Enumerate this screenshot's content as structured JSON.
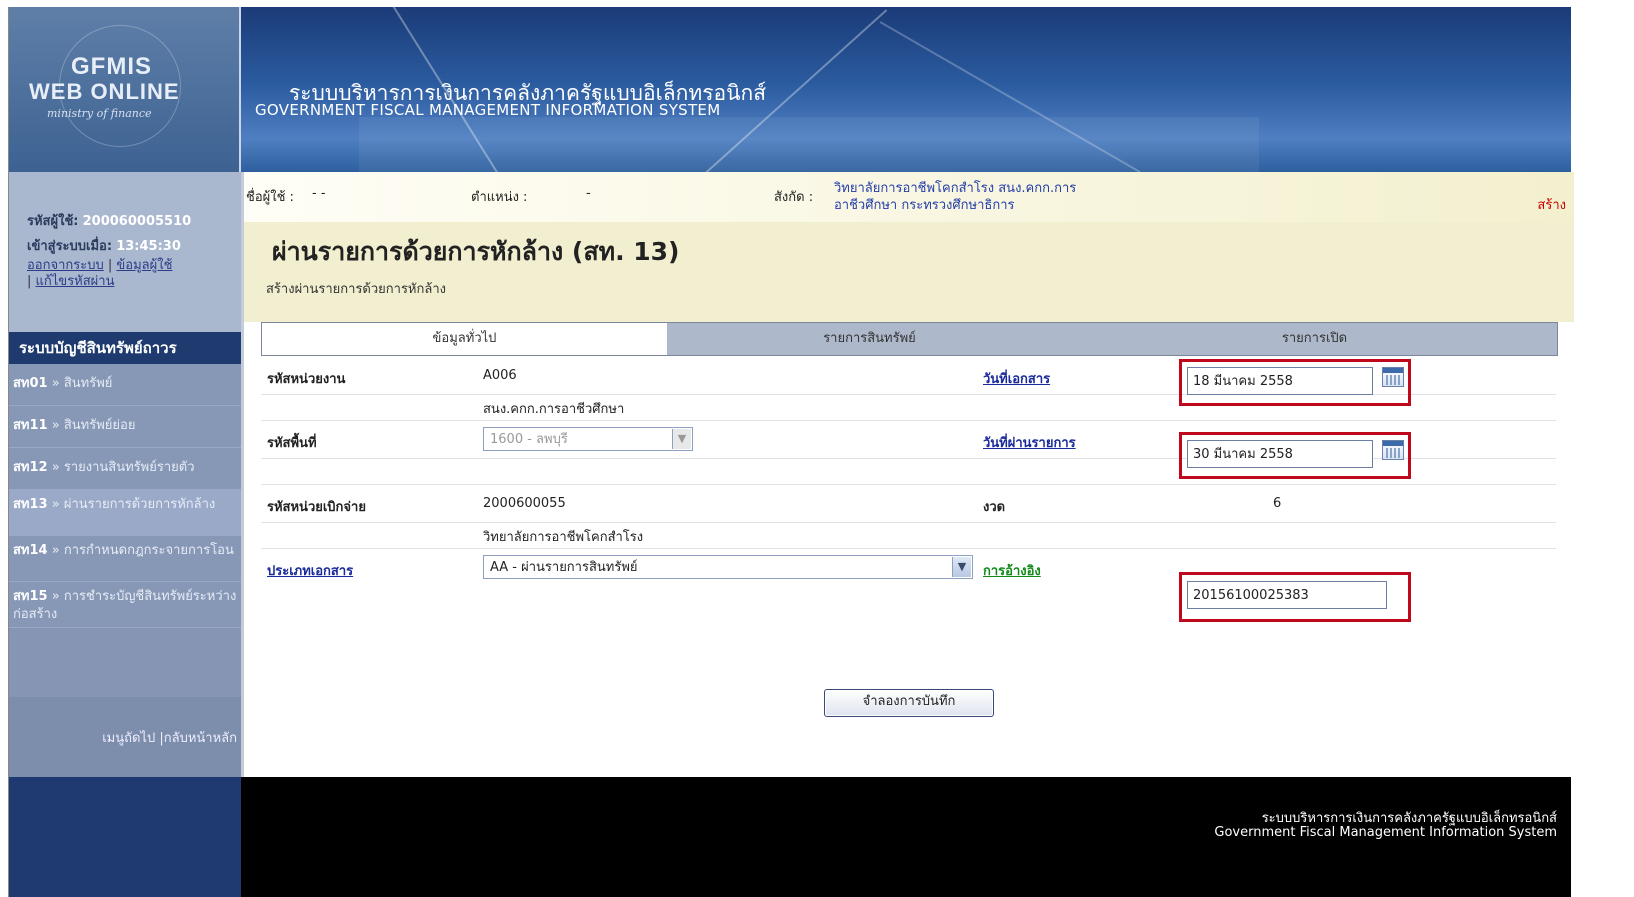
{
  "header": {
    "logo": {
      "line1": "GFMIS",
      "line2": "WEB ONLINE",
      "line3": "ministry of finance"
    },
    "title_th": "ระบบบริหารการเงินการคลังภาครัฐแบบอิเล็กทรอนิกส์",
    "title_en": "GOVERNMENT FISCAL MANAGEMENT INFORMATION SYSTEM"
  },
  "user_panel": {
    "user_id_label": "รหัสผู้ใช้:",
    "user_id": "200060005510",
    "login_label": "เข้าสู่ระบบเมื่อ:",
    "login_time": "13:45:30",
    "links": [
      "ออกจากระบบ",
      "ข้อมูลผู้ใช้",
      "แก้ไขรหัสผ่าน"
    ]
  },
  "sidebar": {
    "heading": "ระบบบัญชีสินทรัพย์ถาวร",
    "items": [
      {
        "code": "สท01",
        "label": "สินทรัพย์"
      },
      {
        "code": "สท11",
        "label": "สินทรัพย์ย่อย"
      },
      {
        "code": "สท12",
        "label": "รายงานสินทรัพย์รายตัว"
      },
      {
        "code": "สท13",
        "label": "ผ่านรายการด้วยการหักล้าง"
      },
      {
        "code": "สท14",
        "label": "การกำหนดกฎกระจายการโอน"
      },
      {
        "code": "สท15",
        "label": "การชำระบัญชีสินทรัพย์ระหว่างก่อสร้าง"
      }
    ],
    "arrow": "»",
    "footer_links": "เมนูถัดไป |กลับหน้าหลัก"
  },
  "info_bar": {
    "username_label": "ชื่อผู้ใช้ :",
    "username_value": "- -",
    "position_label": "ตำแหน่ง :",
    "position_value": "-",
    "affiliation_label": "สังกัด :",
    "affiliation_line1": "วิทยาลัยการอาชีพโคกสำโรง สนง.คกก.การ",
    "affiliation_line2": "อาชีวศึกษา กระทรวงศึกษาธิการ",
    "mode": "สร้าง"
  },
  "page": {
    "title": "ผ่านรายการด้วยการหักล้าง (สท. 13)",
    "subtitle": "สร้างผ่านรายการด้วยการหักล้าง"
  },
  "tabs": [
    "ข้อมูลทั่วไป",
    "รายการสินทรัพย์",
    "รายการเปิด"
  ],
  "form": {
    "agency_code_label": "รหัสหน่วยงาน",
    "agency_code": "A006",
    "agency_name": "สนง.คกก.การอาชีวศึกษา",
    "area_code_label": "รหัสพื้นที่",
    "area_code": "1600 - ลพบุรี",
    "disbursing_unit_label": "รหัสหน่วยเบิกจ่าย",
    "disbursing_unit": "2000600055",
    "disbursing_unit_name": "วิทยาลัยการอาชีพโคกสำโรง",
    "doc_type_label": "ประเภทเอกสาร",
    "doc_type": "AA - ผ่านรายการสินทรัพย์",
    "doc_date_label": "วันที่เอกสาร",
    "doc_date": "18 มีนาคม 2558",
    "post_date_label": "วันที่ผ่านรายการ",
    "post_date": "30 มีนาคม 2558",
    "period_label": "งวด",
    "period": "6",
    "reference_label": "การอ้างอิง",
    "reference": "20156100025383"
  },
  "button": {
    "simulate": "จำลองการบันทึก"
  },
  "footer": {
    "th": "ระบบบริหารการเงินการคลังภาครัฐแบบอิเล็กทรอนิกส์",
    "en": "Government Fiscal Management Information System"
  }
}
